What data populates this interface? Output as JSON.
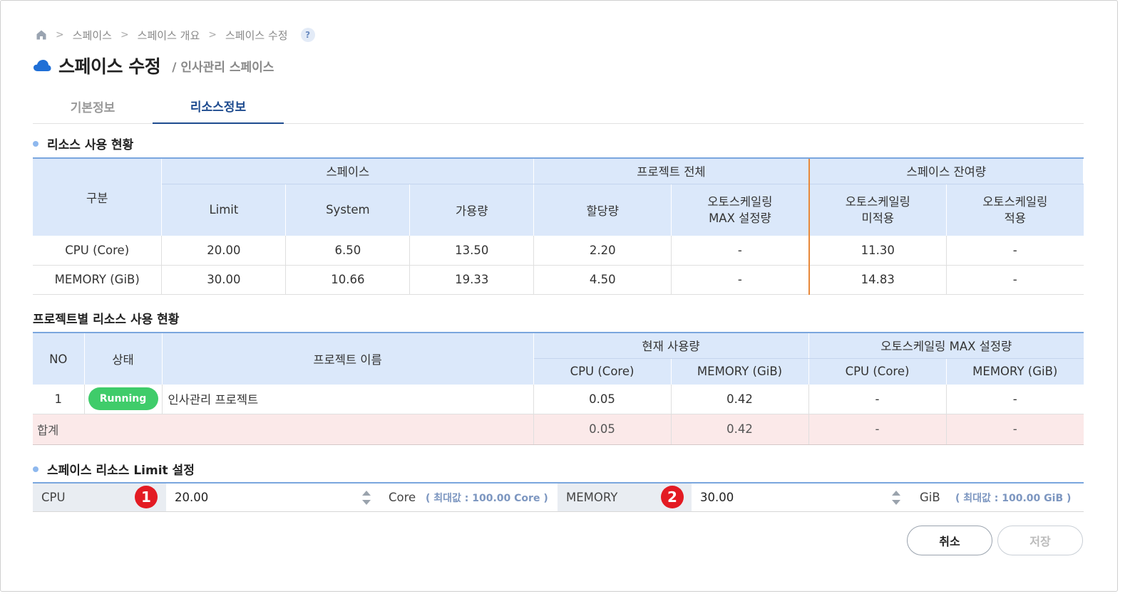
{
  "breadcrumb": {
    "items": [
      "스페이스",
      "스페이스 개요",
      "스페이스 수정"
    ],
    "help": "?"
  },
  "header": {
    "title": "스페이스 수정",
    "subtitle": "/ 인사관리 스페이스"
  },
  "tabs": [
    {
      "label": "기본정보",
      "active": false
    },
    {
      "label": "리소스정보",
      "active": true
    }
  ],
  "resource_usage": {
    "title": "리소스 사용 현황",
    "header": {
      "category": "구분",
      "space": "스페이스",
      "project_total": "프로젝트 전체",
      "space_remaining": "스페이스 잔여량",
      "limit": "Limit",
      "system": "System",
      "available": "가용량",
      "allocated": "할당량",
      "autoscale_max_line1": "오토스케일링",
      "autoscale_max_line2": "MAX 설정량",
      "autoscale_unapplied_line1": "오토스케일링",
      "autoscale_unapplied_line2": "미적용",
      "autoscale_applied_line1": "오토스케일링",
      "autoscale_applied_line2": "적용"
    },
    "rows": [
      {
        "name": "CPU (Core)",
        "limit": "20.00",
        "system": "6.50",
        "available": "13.50",
        "allocated": "2.20",
        "autoscale_max": "-",
        "unapplied": "11.30",
        "applied": "-"
      },
      {
        "name": "MEMORY (GiB)",
        "limit": "30.00",
        "system": "10.66",
        "available": "19.33",
        "allocated": "4.50",
        "autoscale_max": "-",
        "unapplied": "14.83",
        "applied": "-"
      }
    ]
  },
  "project_usage": {
    "title": "프로젝트별 리소스 사용 현황",
    "header": {
      "no": "NO",
      "status": "상태",
      "project_name": "프로젝트 이름",
      "current_usage": "현재 사용량",
      "autoscale_max": "오토스케일링 MAX 설정량",
      "cpu": "CPU (Core)",
      "memory": "MEMORY (GiB)"
    },
    "rows": [
      {
        "no": "1",
        "status": "Running",
        "name": "인사관리 프로젝트",
        "cur_cpu": "0.05",
        "cur_mem": "0.42",
        "max_cpu": "-",
        "max_mem": "-"
      }
    ],
    "sum": {
      "label": "합계",
      "cur_cpu": "0.05",
      "cur_mem": "0.42",
      "max_cpu": "-",
      "max_mem": "-"
    }
  },
  "limit_setting": {
    "title": "스페이스 리소스 Limit 설정",
    "cpu": {
      "label": "CPU",
      "marker": "1",
      "value": "20.00",
      "unit": "Core",
      "max": "( 최대값 :  100.00 Core )"
    },
    "memory": {
      "label": "MEMORY",
      "marker": "2",
      "value": "30.00",
      "unit": "GiB",
      "max": "( 최대값 :  100.00 GiB )"
    }
  },
  "actions": {
    "cancel": "취소",
    "save": "저장"
  },
  "colors": {
    "accent": "#1e4b8f",
    "header_bg": "#dbe8fa",
    "status_running": "#3fcc6a",
    "sum_row_bg": "#fbe9e9",
    "marker_red": "#e31b23",
    "divider_orange": "#e8883a"
  }
}
